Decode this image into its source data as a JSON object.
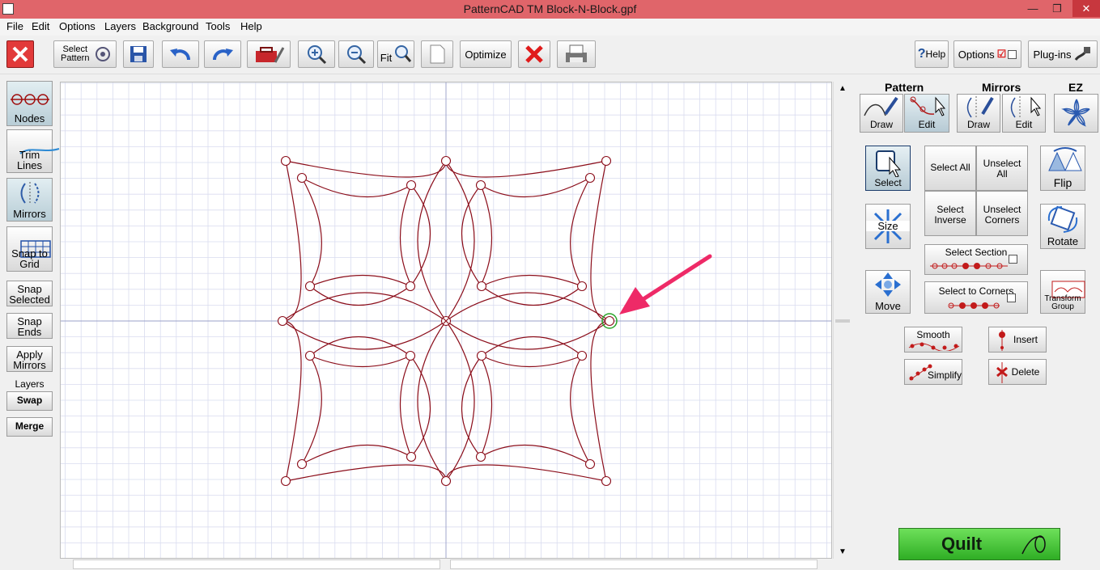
{
  "window": {
    "title": "PatternCAD TM    Block-N-Block.gpf",
    "controls": {
      "minimize": "—",
      "restore": "❐",
      "close": "✕"
    }
  },
  "menu": [
    "File",
    "Edit",
    "Options",
    "Layers",
    "Background",
    "Tools",
    "Help"
  ],
  "toolbar": {
    "select_pattern": "Select\nPattern",
    "fit": "Fit",
    "optimize": "Optimize",
    "help": "Help",
    "options": "Options",
    "plugins": "Plug-ins"
  },
  "left_tools": {
    "nodes": "Nodes",
    "trim_lines": "Trim\nLines",
    "mirrors": "Mirrors",
    "snap_to_grid": "Snap to\nGrid",
    "snap_selected": "Snap\nSelected",
    "snap_ends": "Snap\nEnds",
    "apply_mirrors": "Apply\nMirrors",
    "layers_label": "Layers",
    "swap": "Swap",
    "merge": "Merge"
  },
  "right_panel": {
    "pattern_header": "Pattern",
    "mirrors_header": "Mirrors",
    "ez_header": "EZ",
    "draw": "Draw",
    "edit": "Edit",
    "select": "Select",
    "select_all": "Select All",
    "unselect_all": "Unselect\nAll",
    "select_inverse": "Select\nInverse",
    "unselect_corners": "Unselect\nCorners",
    "flip": "Flip",
    "size": "Size",
    "rotate": "Rotate",
    "select_section": "Select Section",
    "select_to_corners": "Select to Corners",
    "move": "Move",
    "transform_group": "Transform\nGroup",
    "smooth": "Smooth",
    "insert": "Insert",
    "simplify": "Simplify",
    "delete": "Delete",
    "quilt": "Quilt"
  },
  "colors": {
    "titlebar": "#e0656a",
    "pattern_line": "#8b0d1a",
    "grid": "#d9dcef",
    "arrow": "#ee2a67",
    "node_selected": "#2aa52a"
  }
}
